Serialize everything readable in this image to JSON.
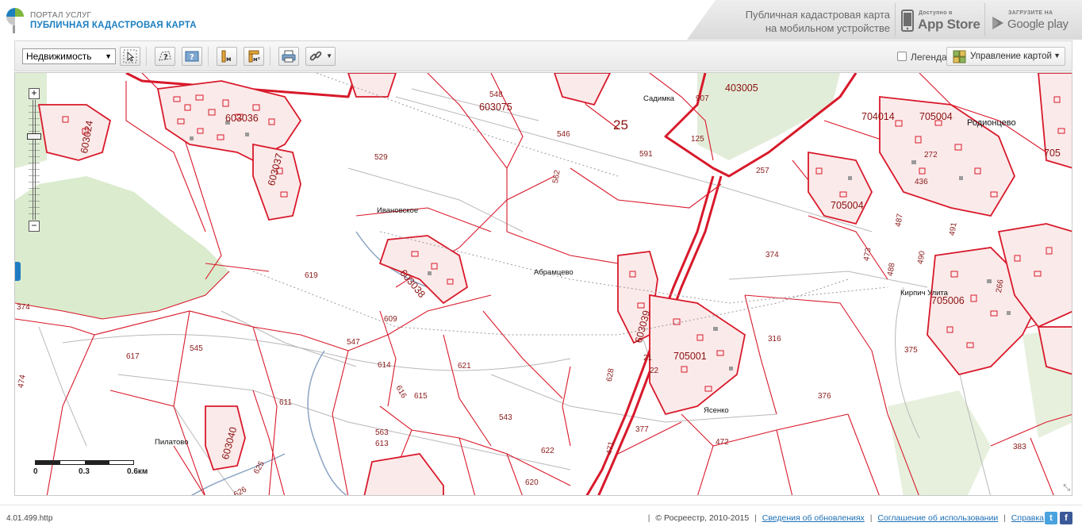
{
  "header": {
    "portal_small": "ПОРТАЛ УСЛУГ",
    "portal_title": "ПУБЛИЧНАЯ КАДАСТРОВАЯ КАРТА",
    "promo_line1": "Публичная кадастровая карта",
    "promo_line2": "на мобильном устройстве",
    "appstore_small": "Доступно в",
    "appstore_big": "App Store",
    "googleplay_small": "ЗАГРУЗИТЕ НА",
    "googleplay_big": "Google play"
  },
  "toolbar": {
    "search_type": "Недвижимость",
    "buttons": [
      "select-tool",
      "identify-area-tool",
      "info-tool",
      "measure-line-tool",
      "measure-area-tool",
      "print-tool",
      "link-tool"
    ],
    "legend_label": "Легенда",
    "legend_checked": false,
    "map_manage_label": "Управление картой"
  },
  "map": {
    "parcel_labels": [
      "603024",
      "603036",
      "603037",
      "603075",
      "25",
      "403005",
      "907",
      "548",
      "546",
      "125",
      "529",
      "591",
      "562",
      "704014",
      "705004",
      "Родионцево",
      "272",
      "436",
      "257",
      "705006",
      "603038",
      "619",
      "374",
      "609",
      "547",
      "545",
      "617",
      "614",
      "616",
      "615",
      "621",
      "611",
      "563",
      "613",
      "543",
      "622",
      "620",
      "603039",
      "705001",
      "21",
      "22",
      "628",
      "377",
      "472",
      "316",
      "376",
      "375",
      "383",
      "603040",
      "625",
      "626",
      "487",
      "488",
      "490",
      "491",
      "266",
      "473",
      "474",
      "471",
      "705",
      "Родионцево"
    ],
    "place_names": [
      "Ивановское",
      "Абрамцево",
      "Пилатово",
      "Кирпич Улита",
      "Ясенко",
      "Садимкa"
    ],
    "scale_labels": [
      "0",
      "0.3",
      "0.6км"
    ],
    "accent_color": "#d8192a",
    "forest_color": "#cfe3bf"
  },
  "footer": {
    "version": "4.01.499.http",
    "copyright": "© Росреестр, 2010-2015",
    "link_updates": "Сведения об обновлениях",
    "link_terms": "Соглашение об использовании",
    "link_help": "Справка"
  }
}
